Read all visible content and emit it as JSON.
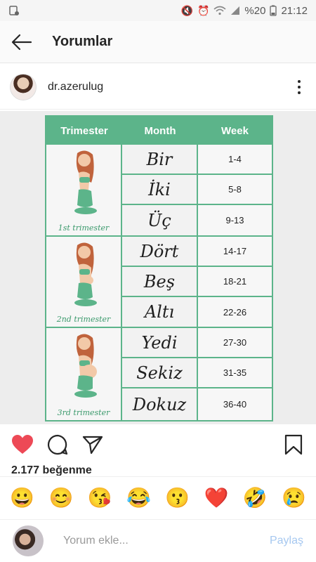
{
  "status_bar": {
    "battery": "%20",
    "time": "21:12"
  },
  "app_bar": {
    "title": "Yorumlar"
  },
  "post": {
    "username": "dr.azerulug"
  },
  "chart": {
    "headers": [
      "Trimester",
      "Month",
      "Week"
    ],
    "trimesters": [
      "1st trimester",
      "2nd trimester",
      "3rd trimester"
    ],
    "rows": [
      {
        "month": "Bir",
        "week": "1-4"
      },
      {
        "month": "İki",
        "week": "5-8"
      },
      {
        "month": "Üç",
        "week": "9-13"
      },
      {
        "month": "Dört",
        "week": "14-17"
      },
      {
        "month": "Beş",
        "week": "18-21"
      },
      {
        "month": "Altı",
        "week": "22-26"
      },
      {
        "month": "Yedi",
        "week": "27-30"
      },
      {
        "month": "Sekiz",
        "week": "31-35"
      },
      {
        "month": "Dokuz",
        "week": "36-40"
      }
    ],
    "accent": "#5cb48a"
  },
  "likes": {
    "text": "2.177 beğenme"
  },
  "emoji_bar": [
    "😀",
    "😊",
    "😘",
    "😂",
    "😗",
    "❤️",
    "🤣",
    "😢"
  ],
  "comment": {
    "placeholder": "Yorum ekle...",
    "share_label": "Paylaş"
  },
  "colors": {
    "like_red": "#ed4956",
    "share_blue": "#a6c8f0"
  }
}
